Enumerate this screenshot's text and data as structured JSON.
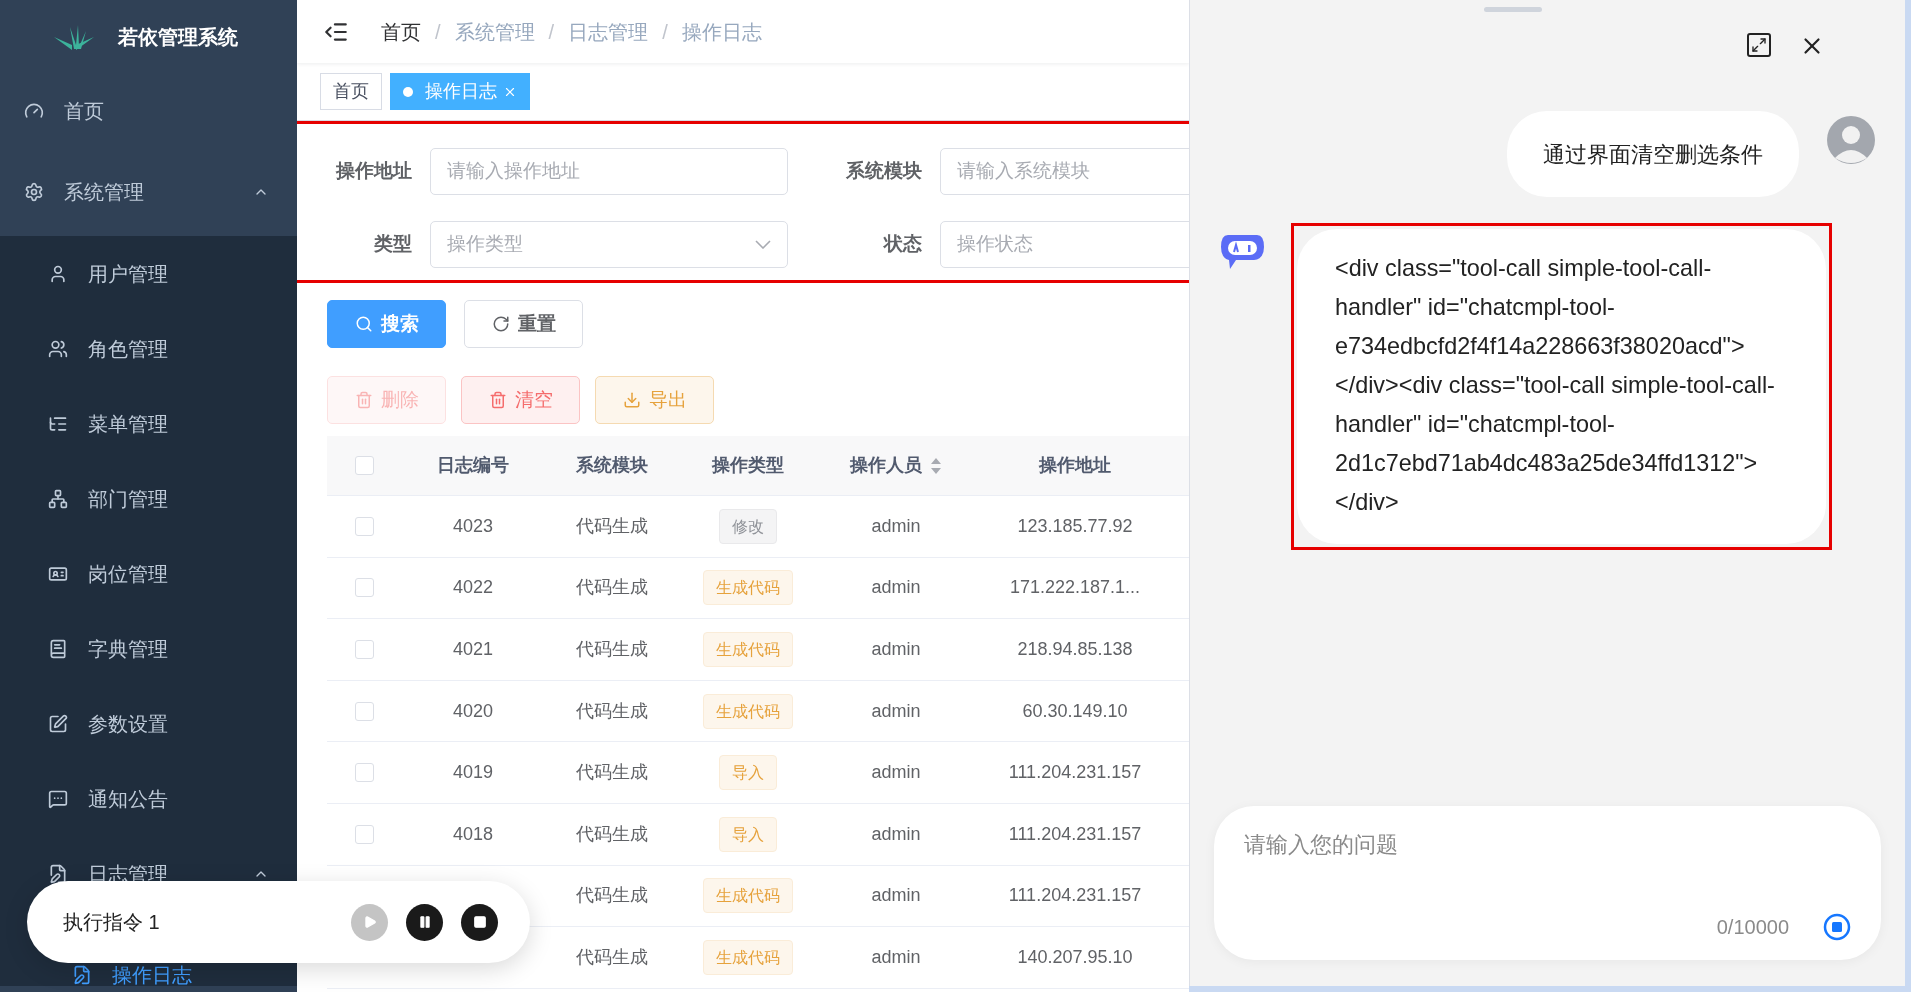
{
  "sidebar": {
    "title": "若依管理系统",
    "items": [
      {
        "label": "首页",
        "selected": false
      },
      {
        "label": "系统管理",
        "selected": false,
        "expanded": true,
        "children": [
          {
            "label": "用户管理",
            "selected": false
          },
          {
            "label": "角色管理",
            "selected": false
          },
          {
            "label": "菜单管理",
            "selected": false
          },
          {
            "label": "部门管理",
            "selected": false
          },
          {
            "label": "岗位管理",
            "selected": false
          },
          {
            "label": "字典管理",
            "selected": false
          },
          {
            "label": "参数设置",
            "selected": false
          },
          {
            "label": "通知公告",
            "selected": false
          },
          {
            "label": "日志管理",
            "selected": false,
            "expanded": true,
            "children": [
              {
                "label": "操作日志",
                "selected": true
              }
            ]
          }
        ]
      }
    ]
  },
  "breadcrumb": {
    "items": [
      "首页",
      "系统管理",
      "日志管理",
      "操作日志"
    ],
    "separators": [
      "/",
      "/",
      "/"
    ]
  },
  "tabs": [
    {
      "label": "首页",
      "selected": false,
      "closable": false
    },
    {
      "label": "操作日志",
      "selected": true,
      "closable": true
    }
  ],
  "filters": [
    {
      "label": "操作地址",
      "placeholder": "请输入操作地址",
      "kind": "text"
    },
    {
      "label": "系统模块",
      "placeholder": "请输入系统模块",
      "kind": "text"
    },
    {
      "label": "类型",
      "placeholder": "操作类型",
      "kind": "select"
    },
    {
      "label": "状态",
      "placeholder": "操作状态",
      "kind": "select"
    }
  ],
  "search_buttons": [
    {
      "label": "搜索",
      "kind": "primary"
    },
    {
      "label": "重置",
      "kind": "default"
    }
  ],
  "actions": [
    {
      "label": "删除",
      "kind": "danger",
      "disabled": true
    },
    {
      "label": "清空",
      "kind": "danger",
      "disabled": false
    },
    {
      "label": "导出",
      "kind": "warning",
      "disabled": false
    }
  ],
  "table": {
    "select_all_checked": false,
    "columns": [
      "日志编号",
      "系统模块",
      "操作类型",
      "操作人员",
      "操作地址"
    ],
    "rows": [
      {
        "id": "4023",
        "module": "代码生成",
        "type": {
          "label": "修改",
          "kind": "info"
        },
        "user": "admin",
        "address": "123.185.77.92",
        "checked": false
      },
      {
        "id": "4022",
        "module": "代码生成",
        "type": {
          "label": "生成代码",
          "kind": "warning"
        },
        "user": "admin",
        "address": "171.222.187.1...",
        "checked": false
      },
      {
        "id": "4021",
        "module": "代码生成",
        "type": {
          "label": "生成代码",
          "kind": "warning"
        },
        "user": "admin",
        "address": "218.94.85.138",
        "checked": false
      },
      {
        "id": "4020",
        "module": "代码生成",
        "type": {
          "label": "生成代码",
          "kind": "warning"
        },
        "user": "admin",
        "address": "60.30.149.10",
        "checked": false
      },
      {
        "id": "4019",
        "module": "代码生成",
        "type": {
          "label": "导入",
          "kind": "warning"
        },
        "user": "admin",
        "address": "111.204.231.157",
        "checked": false
      },
      {
        "id": "4018",
        "module": "代码生成",
        "type": {
          "label": "导入",
          "kind": "warning"
        },
        "user": "admin",
        "address": "111.204.231.157",
        "checked": false
      },
      {
        "module": "代码生成",
        "type": {
          "label": "生成代码",
          "kind": "warning"
        },
        "user": "admin",
        "address": "111.204.231.157"
      },
      {
        "module": "代码生成",
        "type": {
          "label": "生成代码",
          "kind": "warning"
        },
        "user": "admin",
        "address": "140.207.95.10"
      }
    ]
  },
  "runner": {
    "label": "执行指令 1",
    "controls": [
      {
        "kind": "skip",
        "disabled": true
      },
      {
        "kind": "pause",
        "disabled": false
      },
      {
        "kind": "stop",
        "disabled": false
      }
    ]
  },
  "chat": {
    "messages": [
      {
        "kind": "user",
        "text": "通过界面清空删选条件"
      },
      {
        "kind": "bot",
        "text": "<div class=\"tool-call simple-tool-call-handler\" id=\"chatcmpl-tool-e734edbcfd2f4f14a228663f38020acd\"></div><div class=\"tool-call simple-tool-call-handler\" id=\"chatcmpl-tool-2d1c7ebd71ab4dc483a25de34ffd1312\"></div>"
      }
    ],
    "input": {
      "placeholder": "请输入您的问题",
      "counter": "0/10000"
    }
  }
}
